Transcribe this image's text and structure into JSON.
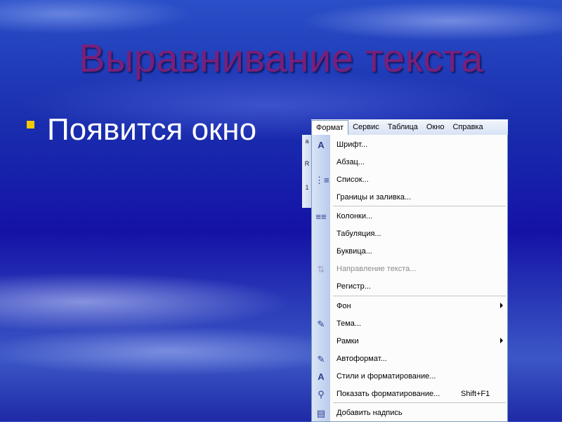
{
  "slide": {
    "title": "Выравнивание текста",
    "bullet": "Появится окно"
  },
  "toolbar_fragment": {
    "glyph_a": "a",
    "glyph_b": "R",
    "glyph_c": "1"
  },
  "menubar": {
    "items": [
      "Формат",
      "Сервис",
      "Таблица",
      "Окно",
      "Справка"
    ]
  },
  "menu": {
    "items": [
      {
        "label": "Шрифт...",
        "icon": "font-A-icon"
      },
      {
        "label": "Абзац...",
        "icon": ""
      },
      {
        "label": "Список...",
        "icon": "list-icon"
      },
      {
        "label": "Границы и заливка...",
        "icon": ""
      },
      {
        "label": "Колонки...",
        "icon": "columns-icon"
      },
      {
        "label": "Табуляция...",
        "icon": ""
      },
      {
        "label": "Буквица...",
        "icon": ""
      },
      {
        "label": "Направление текста...",
        "icon": "text-direction-icon",
        "disabled": true
      },
      {
        "label": "Регистр...",
        "icon": ""
      },
      {
        "label": "Фон",
        "icon": "",
        "submenu": true
      },
      {
        "label": "Тема...",
        "icon": "theme-icon"
      },
      {
        "label": "Рамки",
        "icon": "",
        "submenu": true
      },
      {
        "label": "Автоформат...",
        "icon": "autoformat-icon"
      },
      {
        "label": "Стили и форматирование...",
        "icon": "styles-icon"
      },
      {
        "label": "Показать форматирование...",
        "icon": "reveal-formatting-icon",
        "shortcut": "Shift+F1"
      },
      {
        "label": "Добавить надпись",
        "icon": "textbox-icon"
      }
    ]
  },
  "colors": {
    "title": "#7a1f78",
    "bullet": "#f5c800",
    "bullet_text": "#ffffff"
  }
}
